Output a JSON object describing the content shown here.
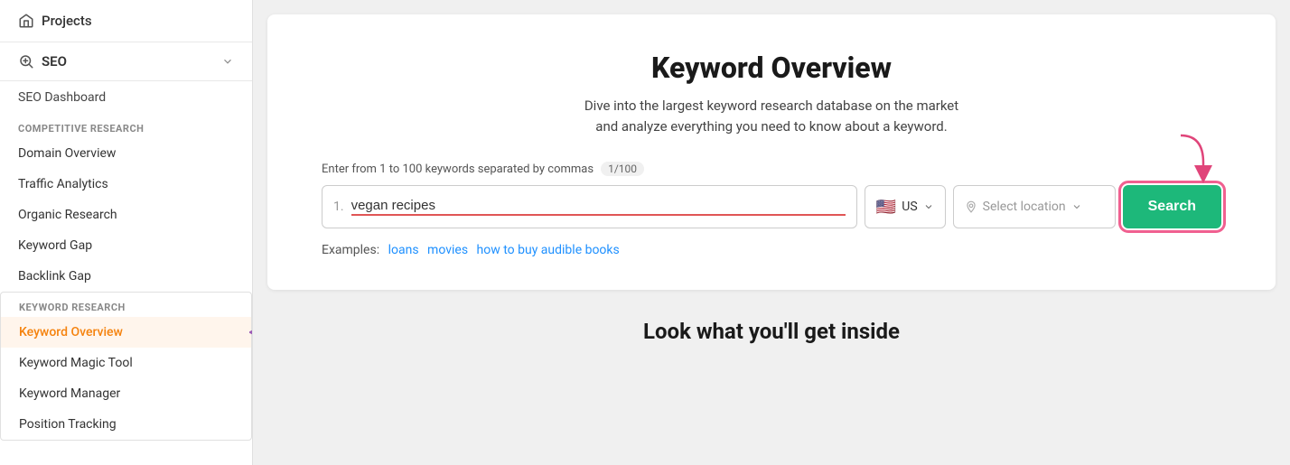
{
  "sidebar": {
    "projects_label": "Projects",
    "seo_label": "SEO",
    "dashboard_label": "SEO Dashboard",
    "competitive_research_label": "COMPETITIVE RESEARCH",
    "items_competitive": [
      {
        "label": "Domain Overview"
      },
      {
        "label": "Traffic Analytics"
      },
      {
        "label": "Organic Research"
      },
      {
        "label": "Keyword Gap"
      },
      {
        "label": "Backlink Gap"
      }
    ],
    "keyword_research_label": "KEYWORD RESEARCH",
    "items_keyword": [
      {
        "label": "Keyword Overview",
        "active": true
      },
      {
        "label": "Keyword Magic Tool"
      },
      {
        "label": "Keyword Manager"
      },
      {
        "label": "Position Tracking"
      }
    ]
  },
  "main": {
    "card": {
      "title": "Keyword Overview",
      "subtitle_line1": "Dive into the largest keyword research database on the market",
      "subtitle_line2": "and analyze everything you need to know about a keyword.",
      "input_label": "Enter from 1 to 100 keywords separated by commas",
      "keyword_count": "1/100",
      "keyword_value": "vegan recipes",
      "keyword_number": "1.",
      "country_code": "US",
      "country_flag": "🇺🇸",
      "location_placeholder": "Select location",
      "search_button_label": "Search",
      "examples_label": "Examples:",
      "examples": [
        {
          "text": "loans"
        },
        {
          "text": "movies"
        },
        {
          "text": "how to buy audible books"
        }
      ]
    },
    "bottom_title": "Look what you'll get inside"
  }
}
